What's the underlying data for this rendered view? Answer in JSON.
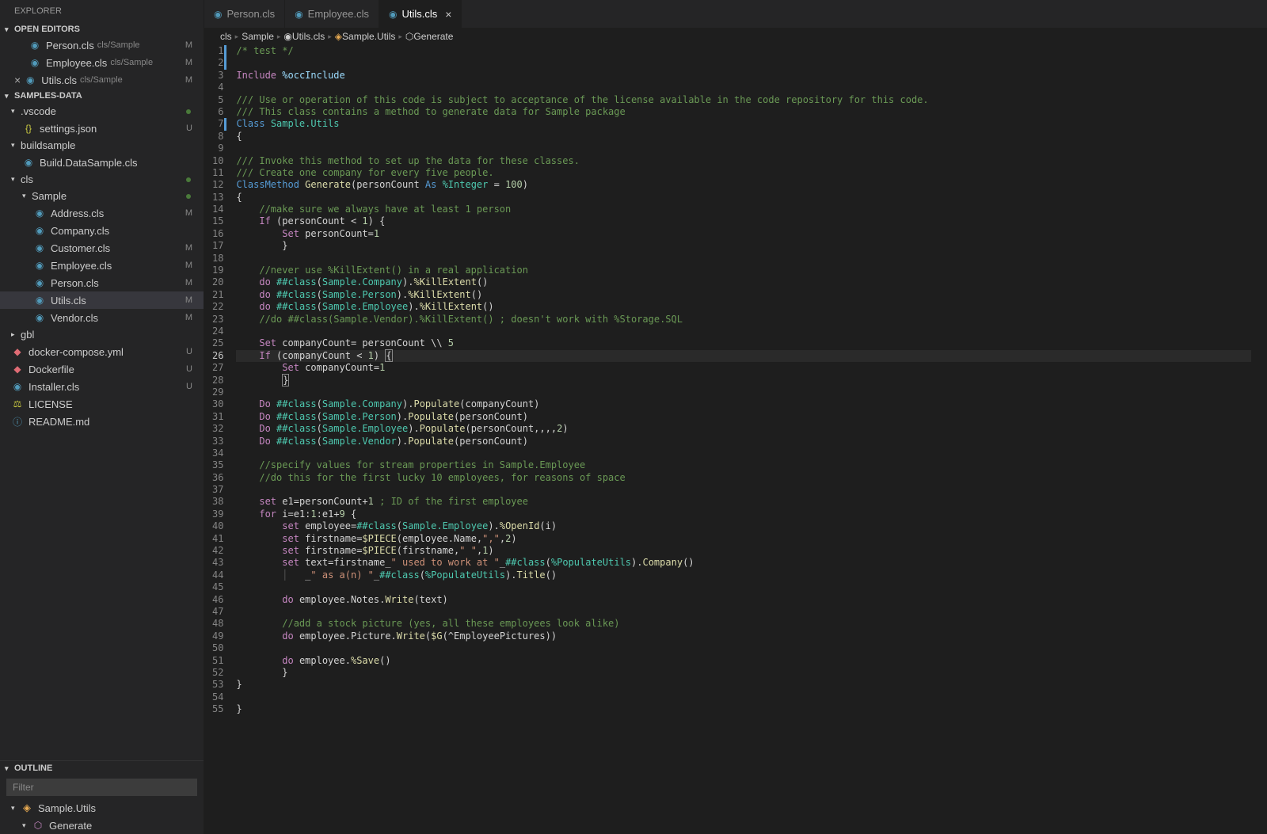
{
  "explorer": {
    "title": "EXPLORER"
  },
  "sections": {
    "openEditors": "OPEN EDITORS",
    "workspace": "SAMPLES-DATA",
    "outline": "OUTLINE"
  },
  "openEditors": [
    {
      "name": "Person.cls",
      "path": "cls/Sample",
      "badge": "M"
    },
    {
      "name": "Employee.cls",
      "path": "cls/Sample",
      "badge": "M"
    },
    {
      "name": "Utils.cls",
      "path": "cls/Sample",
      "badge": "M",
      "close": true
    }
  ],
  "tree": [
    {
      "type": "folder",
      "name": ".vscode",
      "indent": 0,
      "dot": true
    },
    {
      "type": "file",
      "name": "settings.json",
      "indent": 1,
      "icon": "json",
      "badge": "U"
    },
    {
      "type": "folder",
      "name": "buildsample",
      "indent": 0
    },
    {
      "type": "file",
      "name": "Build.DataSample.cls",
      "indent": 1,
      "icon": "cls"
    },
    {
      "type": "folder",
      "name": "cls",
      "indent": 0,
      "dot": true
    },
    {
      "type": "folder",
      "name": "Sample",
      "indent": 1,
      "dot": true
    },
    {
      "type": "file",
      "name": "Address.cls",
      "indent": 2,
      "icon": "cls",
      "badge": "M"
    },
    {
      "type": "file",
      "name": "Company.cls",
      "indent": 2,
      "icon": "cls"
    },
    {
      "type": "file",
      "name": "Customer.cls",
      "indent": 2,
      "icon": "cls",
      "badge": "M"
    },
    {
      "type": "file",
      "name": "Employee.cls",
      "indent": 2,
      "icon": "cls",
      "badge": "M"
    },
    {
      "type": "file",
      "name": "Person.cls",
      "indent": 2,
      "icon": "cls",
      "badge": "M"
    },
    {
      "type": "file",
      "name": "Utils.cls",
      "indent": 2,
      "icon": "cls",
      "badge": "M",
      "active": true
    },
    {
      "type": "file",
      "name": "Vendor.cls",
      "indent": 2,
      "icon": "cls",
      "badge": "M"
    },
    {
      "type": "folder",
      "name": "gbl",
      "indent": 0,
      "collapsed": true
    },
    {
      "type": "file",
      "name": "docker-compose.yml",
      "indent": 0,
      "icon": "docker",
      "badge": "U"
    },
    {
      "type": "file",
      "name": "Dockerfile",
      "indent": 0,
      "icon": "docker",
      "badge": "U"
    },
    {
      "type": "file",
      "name": "Installer.cls",
      "indent": 0,
      "icon": "cls",
      "badge": "U"
    },
    {
      "type": "file",
      "name": "LICENSE",
      "indent": 0,
      "icon": "license"
    },
    {
      "type": "file",
      "name": "README.md",
      "indent": 0,
      "icon": "md"
    }
  ],
  "outline": {
    "filterPlaceholder": "Filter",
    "items": [
      {
        "name": "Sample.Utils",
        "indent": 0,
        "icon": "class"
      },
      {
        "name": "Generate",
        "indent": 1,
        "icon": "cube"
      }
    ]
  },
  "tabs": [
    {
      "name": "Person.cls",
      "active": false
    },
    {
      "name": "Employee.cls",
      "active": false
    },
    {
      "name": "Utils.cls",
      "active": true,
      "close": true
    }
  ],
  "breadcrumb": [
    "cls",
    "Sample",
    "Utils.cls",
    "Sample.Utils",
    "Generate"
  ],
  "code": {
    "lines": [
      {
        "n": 1,
        "mark": true,
        "html": "<span class='c-comment'>/* test */</span>"
      },
      {
        "n": 2,
        "mark": true,
        "html": ""
      },
      {
        "n": 3,
        "html": "<span class='c-keyword'>Include</span> <span class='c-ident'>%occInclude</span>"
      },
      {
        "n": 4,
        "html": ""
      },
      {
        "n": 5,
        "html": "<span class='c-comment'>/// Use or operation of this code is subject to acceptance of the license available in the code repository for this code.</span>"
      },
      {
        "n": 6,
        "html": "<span class='c-comment'>/// This class contains a method to generate data for Sample package</span>"
      },
      {
        "n": 7,
        "mark": true,
        "html": "<span class='c-kw2'>Class</span> <span class='c-type'>Sample.Utils</span>"
      },
      {
        "n": 8,
        "html": "<span class='c-plain'>{</span>"
      },
      {
        "n": 9,
        "html": ""
      },
      {
        "n": 10,
        "html": "<span class='c-comment'>/// Invoke this method to set up the data for these classes.</span>"
      },
      {
        "n": 11,
        "html": "<span class='c-comment'>/// Create one company for every five people.</span>"
      },
      {
        "n": 12,
        "html": "<span class='c-kw2'>ClassMethod</span> <span class='c-func'>Generate</span><span class='c-plain'>(personCount </span><span class='c-kw2'>As</span><span class='c-plain'> </span><span class='c-type'>%Integer</span><span class='c-plain'> = </span><span class='c-num'>100</span><span class='c-plain'>)</span>"
      },
      {
        "n": 13,
        "html": "<span class='c-plain'>{</span>"
      },
      {
        "n": 14,
        "html": "    <span class='c-comment'>//make sure we always have at least 1 person</span>"
      },
      {
        "n": 15,
        "html": "    <span class='c-keyword'>If</span> <span class='c-plain'>(personCount &lt; </span><span class='c-num'>1</span><span class='c-plain'>) {</span>"
      },
      {
        "n": 16,
        "html": "        <span class='c-keyword'>Set</span> <span class='c-plain'>personCount=</span><span class='c-num'>1</span>"
      },
      {
        "n": 17,
        "html": "        <span class='c-plain'>}</span>"
      },
      {
        "n": 18,
        "html": ""
      },
      {
        "n": 19,
        "html": "    <span class='c-comment'>//never use %KillExtent() in a real application</span>"
      },
      {
        "n": 20,
        "html": "    <span class='c-keyword'>do</span> <span class='c-macro'>##class</span><span class='c-plain'>(</span><span class='c-type'>Sample.Company</span><span class='c-plain'>).</span><span class='c-func'>%KillExtent</span><span class='c-plain'>()</span>"
      },
      {
        "n": 21,
        "html": "    <span class='c-keyword'>do</span> <span class='c-macro'>##class</span><span class='c-plain'>(</span><span class='c-type'>Sample.Person</span><span class='c-plain'>).</span><span class='c-func'>%KillExtent</span><span class='c-plain'>()</span>"
      },
      {
        "n": 22,
        "html": "    <span class='c-keyword'>do</span> <span class='c-macro'>##class</span><span class='c-plain'>(</span><span class='c-type'>Sample.Employee</span><span class='c-plain'>).</span><span class='c-func'>%KillExtent</span><span class='c-plain'>()</span>"
      },
      {
        "n": 23,
        "html": "    <span class='c-comment'>//do ##class(Sample.Vendor).%KillExtent() ; doesn't work with %Storage.SQL</span>"
      },
      {
        "n": 24,
        "html": ""
      },
      {
        "n": 25,
        "html": "    <span class='c-keyword'>Set</span> <span class='c-plain'>companyCount= personCount \\\\ </span><span class='c-num'>5</span>"
      },
      {
        "n": 26,
        "html": "    <span class='c-keyword'>If</span> <span class='c-plain'>(companyCount &lt; </span><span class='c-num'>1</span><span class='c-plain'>)</span> <span class='c-plain' style='border:1px solid #888;padding:0;'>{</span>",
        "hl": true
      },
      {
        "n": 27,
        "html": "        <span class='c-keyword'>Set</span> <span class='c-plain'>companyCount=</span><span class='c-num'>1</span>"
      },
      {
        "n": 28,
        "html": "        <span class='c-plain' style='border:1px solid #888;'>}</span>"
      },
      {
        "n": 29,
        "html": ""
      },
      {
        "n": 30,
        "html": "    <span class='c-keyword'>Do</span> <span class='c-macro'>##class</span><span class='c-plain'>(</span><span class='c-type'>Sample.Company</span><span class='c-plain'>).</span><span class='c-func'>Populate</span><span class='c-plain'>(companyCount)</span>"
      },
      {
        "n": 31,
        "html": "    <span class='c-keyword'>Do</span> <span class='c-macro'>##class</span><span class='c-plain'>(</span><span class='c-type'>Sample.Person</span><span class='c-plain'>).</span><span class='c-func'>Populate</span><span class='c-plain'>(personCount)</span>"
      },
      {
        "n": 32,
        "html": "    <span class='c-keyword'>Do</span> <span class='c-macro'>##class</span><span class='c-plain'>(</span><span class='c-type'>Sample.Employee</span><span class='c-plain'>).</span><span class='c-func'>Populate</span><span class='c-plain'>(personCount,,,,</span><span class='c-num'>2</span><span class='c-plain'>)</span>"
      },
      {
        "n": 33,
        "html": "    <span class='c-keyword'>Do</span> <span class='c-macro'>##class</span><span class='c-plain'>(</span><span class='c-type'>Sample.Vendor</span><span class='c-plain'>).</span><span class='c-func'>Populate</span><span class='c-plain'>(personCount)</span>"
      },
      {
        "n": 34,
        "html": ""
      },
      {
        "n": 35,
        "html": "    <span class='c-comment'>//specify values for stream properties in Sample.Employee</span>"
      },
      {
        "n": 36,
        "html": "    <span class='c-comment'>//do this for the first lucky 10 employees, for reasons of space</span>"
      },
      {
        "n": 37,
        "html": ""
      },
      {
        "n": 38,
        "html": "    <span class='c-keyword'>set</span> <span class='c-plain'>e1=personCount+</span><span class='c-num'>1</span> <span class='c-comment'>; ID of the first employee</span>"
      },
      {
        "n": 39,
        "html": "    <span class='c-keyword'>for</span> <span class='c-plain'>i=e1:</span><span class='c-num'>1</span><span class='c-plain'>:e1+</span><span class='c-num'>9</span><span class='c-plain'> {</span>"
      },
      {
        "n": 40,
        "html": "        <span class='c-keyword'>set</span> <span class='c-plain'>employee=</span><span class='c-macro'>##class</span><span class='c-plain'>(</span><span class='c-type'>Sample.Employee</span><span class='c-plain'>).</span><span class='c-func'>%OpenId</span><span class='c-plain'>(i)</span>"
      },
      {
        "n": 41,
        "html": "        <span class='c-keyword'>set</span> <span class='c-plain'>firstname=</span><span class='c-func'>$PIECE</span><span class='c-plain'>(employee.Name,</span><span class='c-str'>\",\"</span><span class='c-plain'>,</span><span class='c-num'>2</span><span class='c-plain'>)</span>"
      },
      {
        "n": 42,
        "html": "        <span class='c-keyword'>set</span> <span class='c-plain'>firstname=</span><span class='c-func'>$PIECE</span><span class='c-plain'>(firstname,</span><span class='c-str'>\" \"</span><span class='c-plain'>,</span><span class='c-num'>1</span><span class='c-plain'>)</span>"
      },
      {
        "n": 43,
        "html": "        <span class='c-keyword'>set</span> <span class='c-plain'>text=firstname_</span><span class='c-str'>\" used to work at \"</span><span class='c-plain'>_</span><span class='c-macro'>##class</span><span class='c-plain'>(</span><span class='c-type'>%PopulateUtils</span><span class='c-plain'>).</span><span class='c-func'>Company</span><span class='c-plain'>()</span>"
      },
      {
        "n": 44,
        "html": "        <span class='c-plain' style='color:#555'>│   </span><span class='c-plain'>_</span><span class='c-str'>\" as a(n) \"</span><span class='c-plain'>_</span><span class='c-macro'>##class</span><span class='c-plain'>(</span><span class='c-type'>%PopulateUtils</span><span class='c-plain'>).</span><span class='c-func'>Title</span><span class='c-plain'>()</span>"
      },
      {
        "n": 45,
        "html": ""
      },
      {
        "n": 46,
        "html": "        <span class='c-keyword'>do</span> <span class='c-plain'>employee.Notes.</span><span class='c-func'>Write</span><span class='c-plain'>(text)</span>"
      },
      {
        "n": 47,
        "html": ""
      },
      {
        "n": 48,
        "html": "        <span class='c-comment'>//add a stock picture (yes, all these employees look alike)</span>"
      },
      {
        "n": 49,
        "html": "        <span class='c-keyword'>do</span> <span class='c-plain'>employee.Picture.</span><span class='c-func'>Write</span><span class='c-plain'>(</span><span class='c-func'>$G</span><span class='c-plain'>(^EmployeePictures))</span>"
      },
      {
        "n": 50,
        "html": ""
      },
      {
        "n": 51,
        "html": "        <span class='c-keyword'>do</span> <span class='c-plain'>employee.</span><span class='c-func'>%Save</span><span class='c-plain'>()</span>"
      },
      {
        "n": 52,
        "html": "        <span class='c-plain'>}</span>"
      },
      {
        "n": 53,
        "html": "<span class='c-plain'>}</span>"
      },
      {
        "n": 54,
        "html": ""
      },
      {
        "n": 55,
        "html": "<span class='c-plain'>}</span>"
      }
    ]
  }
}
